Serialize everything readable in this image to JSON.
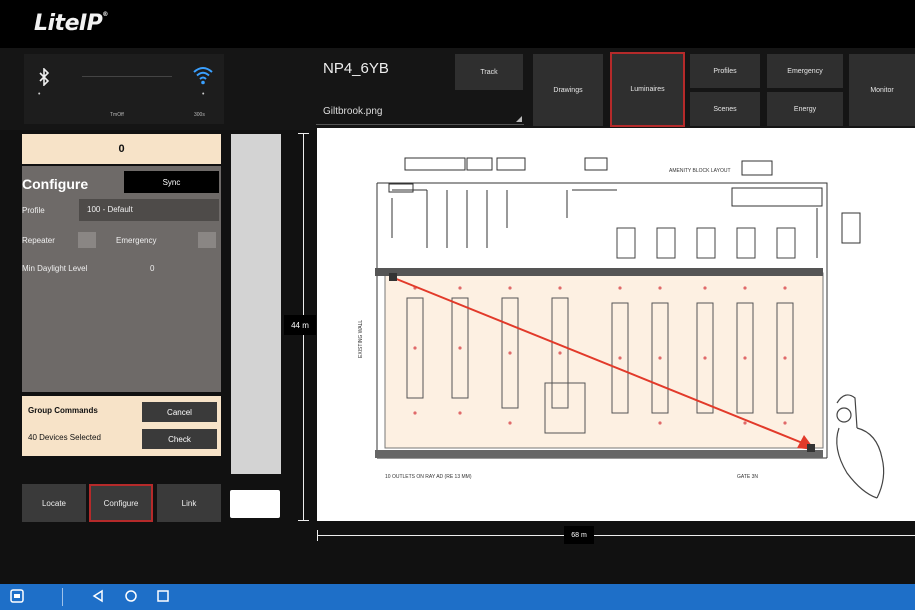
{
  "app": {
    "logo": "LiteIP",
    "logo_mark": "®"
  },
  "connection": {
    "bluetooth_status": "•",
    "wifi_status": "•",
    "left_label": "TmOff",
    "right_label": "300s"
  },
  "project": {
    "name": "NP4_6YB",
    "file": "Giltbrook.png"
  },
  "toolbar": {
    "track": "Track",
    "drawings": "Drawings",
    "luminaires": "Luminaires",
    "profiles": "Profiles",
    "emergency": "Emergency",
    "scenes": "Scenes",
    "energy": "Energy",
    "monitor": "Monitor"
  },
  "panel": {
    "count": "0",
    "configure_title": "Configure",
    "sync_label": "Sync",
    "profile_label": "Profile",
    "profile_value": "100 - Default",
    "repeater_label": "Repeater",
    "emergency_label": "Emergency",
    "min_daylight_label": "Min Daylight Level",
    "min_daylight_value": "0"
  },
  "group": {
    "title": "Group Commands",
    "selected": "40 Devices Selected",
    "cancel": "Cancel",
    "check": "Check"
  },
  "bottom_buttons": {
    "locate": "Locate",
    "configure": "Configure",
    "link": "Link"
  },
  "drawing": {
    "height_label": "44 m",
    "width_label": "68 m",
    "plan_title": "AMENITY BLOCK LAYOUT",
    "plan_note": "10 OUTLETS ON RAY AD (RE 13 MM)",
    "plan_gate": "GATE 3N",
    "wall_label": "EXISTING WALL"
  },
  "colors": {
    "active_border": "#b52a2a",
    "accent_blue": "#1e6fc8",
    "cream": "#f7e3c8"
  },
  "navbar": {
    "icons": [
      "app-switch-icon",
      "back-icon",
      "home-icon",
      "recents-icon"
    ]
  }
}
